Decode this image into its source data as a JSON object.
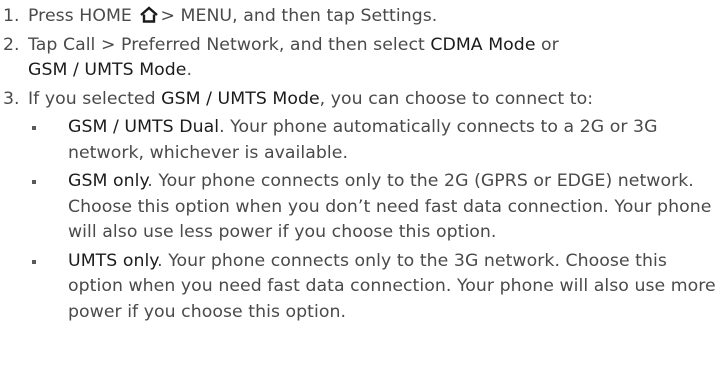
{
  "steps": [
    {
      "number": "1.",
      "text_before_icon": "Press HOME ",
      "icon": "home-icon",
      "text_after_icon": "> MENU, and then tap Settings."
    },
    {
      "number": "2.",
      "text_a": "Tap Call > Preferred Network, and then select ",
      "option_cdma": "CDMA Mode",
      "text_b": " or ",
      "option_gsm_umts": "GSM / UMTS Mode",
      "text_c": "."
    },
    {
      "number": "3.",
      "text_a": "If you selected ",
      "option_gsm_umts": "GSM / UMTS Mode",
      "text_b": ", you can choose to connect to:",
      "options": [
        {
          "title": "GSM / UMTS Dual",
          "description": ". Your phone automatically connects to a 2G or 3G network, whichever is available."
        },
        {
          "title": "GSM only",
          "description": ". Your phone connects only to the 2G (GPRS or EDGE) network. Choose this option when you don’t need fast data connection. Your phone will also use less power if you choose this option."
        },
        {
          "title": "UMTS only",
          "description": ". Your phone connects only to the 3G network. Choose this option when you need fast data connection. Your phone will also use more power if you choose this option."
        }
      ]
    }
  ],
  "colors": {
    "body_text": "#4a4a4a",
    "emphasis_text": "#1b1b1b"
  }
}
